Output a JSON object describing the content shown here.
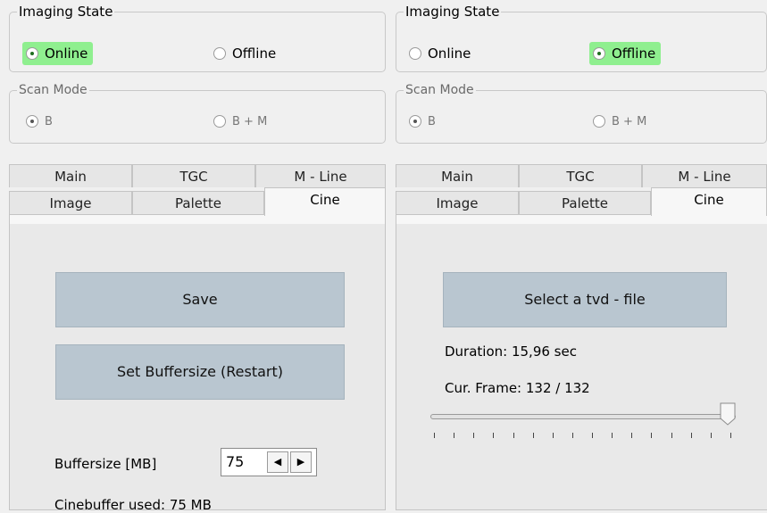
{
  "left": {
    "imaging_state": {
      "title": "Imaging State",
      "online": "Online",
      "offline": "Offline",
      "selected": "online"
    },
    "scan_mode": {
      "title": "Scan Mode",
      "b": "B",
      "bm": "B + M",
      "selected": "b"
    },
    "tabs_row1": [
      "Main",
      "TGC",
      "M - Line"
    ],
    "tabs_row2": [
      "Image",
      "Palette",
      "Cine"
    ],
    "active_tab": "Cine",
    "save_label": "Save",
    "set_buffer_label": "Set Buffersize (Restart)",
    "buffersize_label": "Buffersize [MB]",
    "buffersize_value": "75",
    "cinebuffer_used_label": "Cinebuffer used:",
    "cinebuffer_used_value": "75 MB"
  },
  "right": {
    "imaging_state": {
      "title": "Imaging State",
      "online": "Online",
      "offline": "Offline",
      "selected": "offline"
    },
    "scan_mode": {
      "title": "Scan Mode",
      "b": "B",
      "bm": "B + M",
      "selected": "b"
    },
    "tabs_row1": [
      "Main",
      "TGC",
      "M - Line"
    ],
    "tabs_row2": [
      "Image",
      "Palette",
      "Cine"
    ],
    "active_tab": "Cine",
    "select_file_label": "Select a tvd - file",
    "duration": "Duration: 15,96 sec",
    "cur_frame": "Cur. Frame: 132 / 132",
    "frame_slider_fraction": 1.0
  },
  "colors": {
    "selected_radio_bg": "#8fef8f",
    "button_bg": "#b9c6d0",
    "panel_bg": "#f0f0f0"
  }
}
